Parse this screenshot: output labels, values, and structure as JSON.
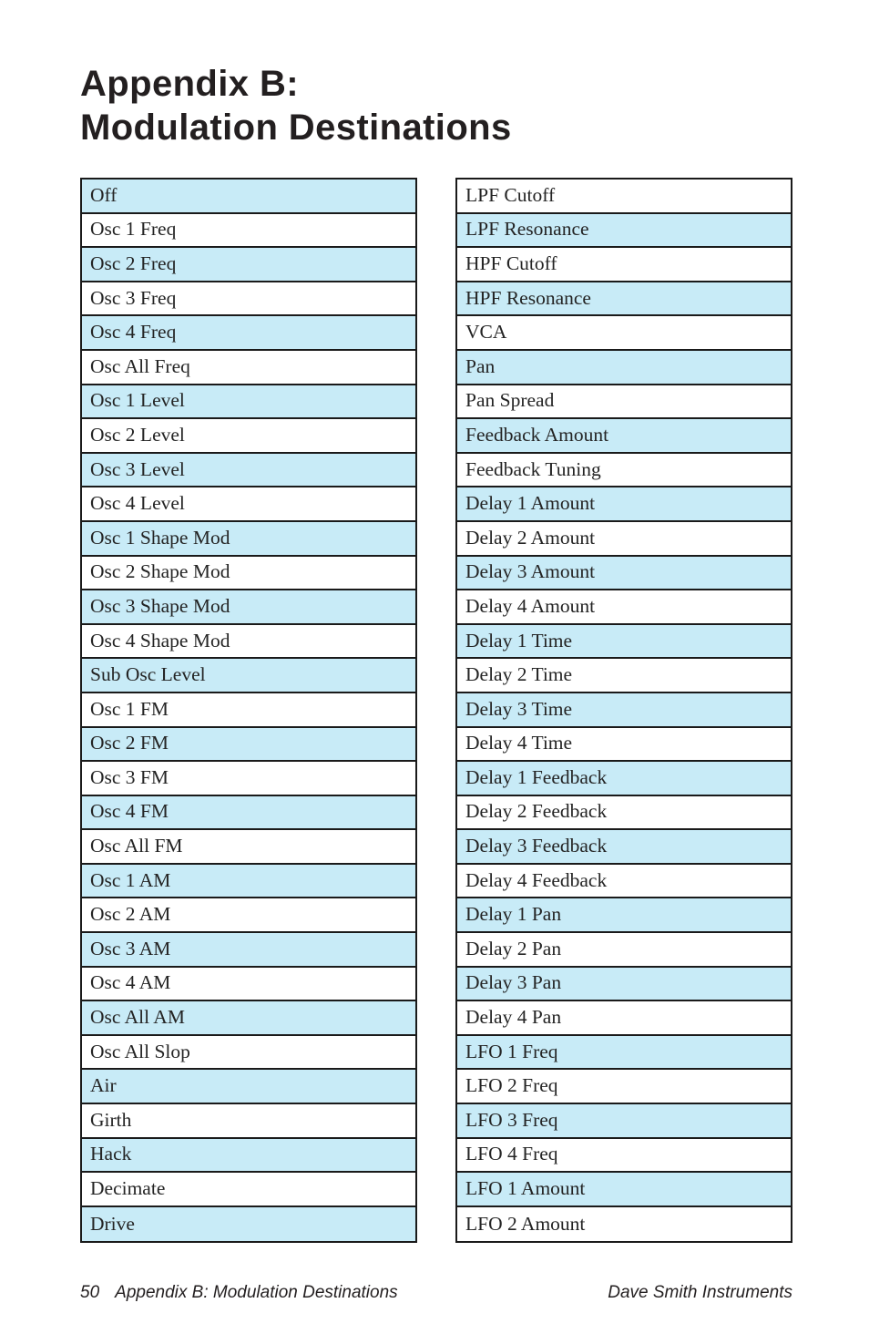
{
  "title": {
    "line1": "Appendix B:",
    "line2": "Modulation Destinations"
  },
  "colors": {
    "shaded_row": "#c8ebf7",
    "plain_row": "#ffffff",
    "border": "#1a1a1a",
    "text": "#242424",
    "title_text": "#231f20"
  },
  "tables": {
    "left": {
      "rows": [
        {
          "label": "Off",
          "shaded": true
        },
        {
          "label": "Osc 1 Freq",
          "shaded": false
        },
        {
          "label": "Osc 2 Freq",
          "shaded": true
        },
        {
          "label": "Osc 3 Freq",
          "shaded": false
        },
        {
          "label": "Osc 4 Freq",
          "shaded": true
        },
        {
          "label": "Osc All Freq",
          "shaded": false
        },
        {
          "label": "Osc 1 Level",
          "shaded": true
        },
        {
          "label": "Osc 2 Level",
          "shaded": false
        },
        {
          "label": "Osc 3 Level",
          "shaded": true
        },
        {
          "label": "Osc 4 Level",
          "shaded": false
        },
        {
          "label": "Osc 1 Shape Mod",
          "shaded": true
        },
        {
          "label": "Osc 2 Shape Mod",
          "shaded": false
        },
        {
          "label": "Osc 3 Shape Mod",
          "shaded": true
        },
        {
          "label": "Osc 4 Shape Mod",
          "shaded": false
        },
        {
          "label": "Sub Osc Level",
          "shaded": true
        },
        {
          "label": "Osc 1 FM",
          "shaded": false
        },
        {
          "label": "Osc 2 FM",
          "shaded": true
        },
        {
          "label": "Osc 3 FM",
          "shaded": false
        },
        {
          "label": "Osc 4 FM",
          "shaded": true
        },
        {
          "label": "Osc All FM",
          "shaded": false
        },
        {
          "label": "Osc 1 AM",
          "shaded": true
        },
        {
          "label": "Osc 2 AM",
          "shaded": false
        },
        {
          "label": "Osc 3 AM",
          "shaded": true
        },
        {
          "label": "Osc 4 AM",
          "shaded": false
        },
        {
          "label": "Osc All AM",
          "shaded": true
        },
        {
          "label": "Osc All Slop",
          "shaded": false
        },
        {
          "label": "Air",
          "shaded": true
        },
        {
          "label": "Girth",
          "shaded": false
        },
        {
          "label": "Hack",
          "shaded": true
        },
        {
          "label": "Decimate",
          "shaded": false
        },
        {
          "label": "Drive",
          "shaded": true
        }
      ]
    },
    "right": {
      "rows": [
        {
          "label": "LPF Cutoff",
          "shaded": false
        },
        {
          "label": "LPF Resonance",
          "shaded": true
        },
        {
          "label": "HPF Cutoff",
          "shaded": false
        },
        {
          "label": "HPF Resonance",
          "shaded": true
        },
        {
          "label": "VCA",
          "shaded": false
        },
        {
          "label": "Pan",
          "shaded": true
        },
        {
          "label": "Pan Spread",
          "shaded": false
        },
        {
          "label": "Feedback Amount",
          "shaded": true
        },
        {
          "label": "Feedback Tuning",
          "shaded": false
        },
        {
          "label": "Delay 1 Amount",
          "shaded": true
        },
        {
          "label": "Delay 2 Amount",
          "shaded": false
        },
        {
          "label": "Delay 3 Amount",
          "shaded": true
        },
        {
          "label": "Delay 4 Amount",
          "shaded": false
        },
        {
          "label": "Delay 1 Time",
          "shaded": true
        },
        {
          "label": "Delay 2 Time",
          "shaded": false
        },
        {
          "label": "Delay 3 Time",
          "shaded": true
        },
        {
          "label": "Delay 4 Time",
          "shaded": false
        },
        {
          "label": "Delay 1 Feedback",
          "shaded": true
        },
        {
          "label": "Delay 2 Feedback",
          "shaded": false
        },
        {
          "label": "Delay 3 Feedback",
          "shaded": true
        },
        {
          "label": "Delay 4 Feedback",
          "shaded": false
        },
        {
          "label": "Delay 1 Pan",
          "shaded": true
        },
        {
          "label": "Delay 2 Pan",
          "shaded": false
        },
        {
          "label": "Delay 3 Pan",
          "shaded": true
        },
        {
          "label": "Delay 4 Pan",
          "shaded": false
        },
        {
          "label": "LFO 1 Freq",
          "shaded": true
        },
        {
          "label": "LFO 2 Freq",
          "shaded": false
        },
        {
          "label": "LFO 3 Freq",
          "shaded": true
        },
        {
          "label": "LFO 4 Freq",
          "shaded": false
        },
        {
          "label": "LFO 1 Amount",
          "shaded": true
        },
        {
          "label": "LFO 2 Amount",
          "shaded": false
        }
      ]
    }
  },
  "footer": {
    "page_number": "50",
    "chapter": "Appendix B: Modulation Destinations",
    "company": "Dave Smith Instruments"
  }
}
